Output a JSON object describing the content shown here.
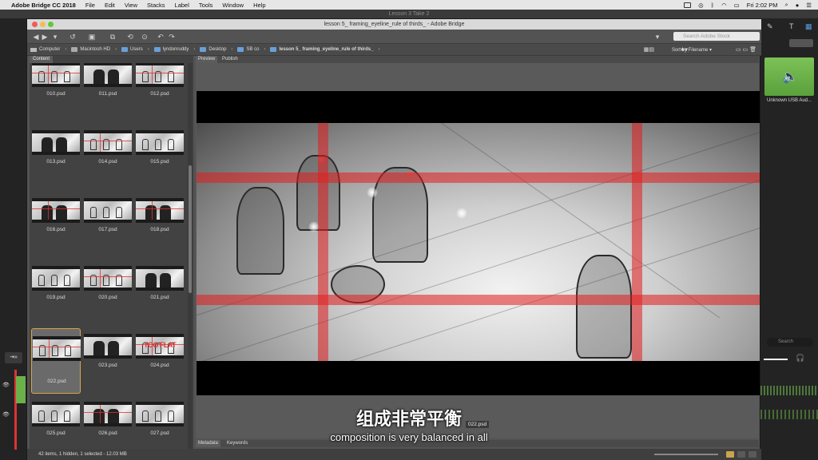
{
  "menubar": {
    "app": "Adobe Bridge CC 2018",
    "items": [
      "File",
      "Edit",
      "View",
      "Stacks",
      "Label",
      "Tools",
      "Window",
      "Help"
    ],
    "clock": "Fri 2:02 PM"
  },
  "outer_title": "Lesson 3 Take 2",
  "window_title": "lesson 5_ framing_eyeline_rule of thirds_ - Adobe Bridge",
  "search": {
    "placeholder": "Search Adobe Stock"
  },
  "path": [
    "Computer",
    "Macintosh HD",
    "Users",
    "lyndonruddy",
    "Desktop",
    "SB co",
    "lesson 5_ framing_eyeline_rule of thirds_"
  ],
  "sort_label": "Sort by Filename",
  "content_tab": "Content",
  "preview_tabs": [
    "Preview",
    "Publish"
  ],
  "meta_tabs": [
    "Metadata",
    "Keywords"
  ],
  "thumbnails": [
    {
      "name": "010.psd"
    },
    {
      "name": "011.psd"
    },
    {
      "name": "012.psd"
    },
    {
      "name": "013.psd"
    },
    {
      "name": "014.psd"
    },
    {
      "name": "015.psd"
    },
    {
      "name": "016.psd"
    },
    {
      "name": "017.psd"
    },
    {
      "name": "018.psd"
    },
    {
      "name": "019.psd"
    },
    {
      "name": "020.psd"
    },
    {
      "name": "021.psd"
    },
    {
      "name": "022.psd",
      "selected": true
    },
    {
      "name": "023.psd"
    },
    {
      "name": "024.psd",
      "overlay": "TOO FLAT"
    },
    {
      "name": "025.psd"
    },
    {
      "name": "026.psd"
    },
    {
      "name": "027.psd"
    }
  ],
  "preview_filename": "022.psd",
  "status": "42 items, 1 hidden, 1 selected - 12.03 MB",
  "right_panel": {
    "audio_label": "Unknown USB Aud...",
    "search_placeholder": "Search"
  },
  "subtitle_cn": "组成非常平衡",
  "subtitle_en": "composition is very balanced in all",
  "colors": {
    "accent_green": "#6bb04a",
    "selection": "#d9a44a",
    "rule_of_thirds": "#e11e1e"
  }
}
